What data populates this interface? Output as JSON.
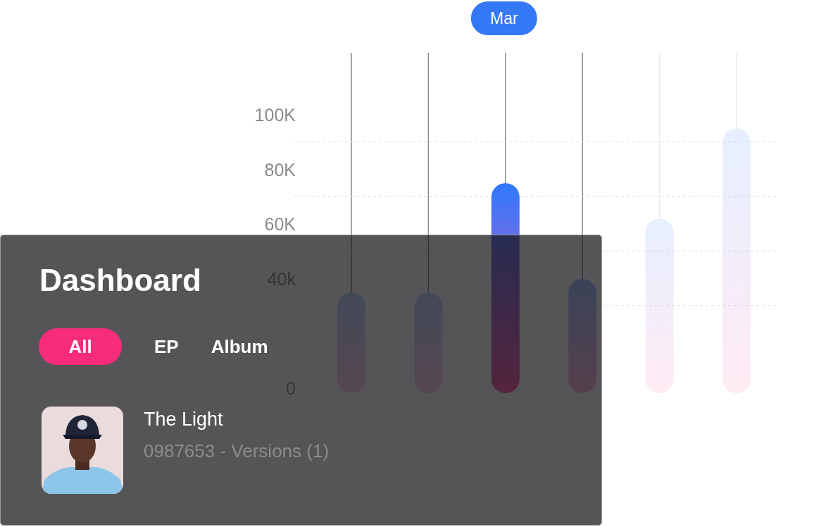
{
  "chart": {
    "chart_data": {
      "type": "bar",
      "values": [
        35000,
        35000,
        75000,
        40000,
        62000,
        95000
      ],
      "ylim": [
        0,
        100000
      ],
      "yticks": [
        {
          "value": 0,
          "label": "0"
        },
        {
          "value": 40000,
          "label": "40k"
        },
        {
          "value": 60000,
          "label": "60K"
        },
        {
          "value": 80000,
          "label": "80K"
        },
        {
          "value": 100000,
          "label": "100K"
        }
      ],
      "annotations": [
        {
          "text": "Mar"
        }
      ]
    },
    "bars": [
      {
        "selected": false
      },
      {
        "selected": false
      },
      {
        "selected": true
      },
      {
        "selected": false
      },
      {
        "selected": false
      },
      {
        "selected": false
      }
    ]
  },
  "panel": {
    "title": "Dashboard",
    "tabs": [
      {
        "label": "All",
        "selected": true
      },
      {
        "label": "EP",
        "selected": false
      },
      {
        "label": "Album",
        "selected": false
      }
    ],
    "tracks": [
      {
        "title": "The Light",
        "subtitle": "0987653 - Versions (1)"
      }
    ]
  }
}
